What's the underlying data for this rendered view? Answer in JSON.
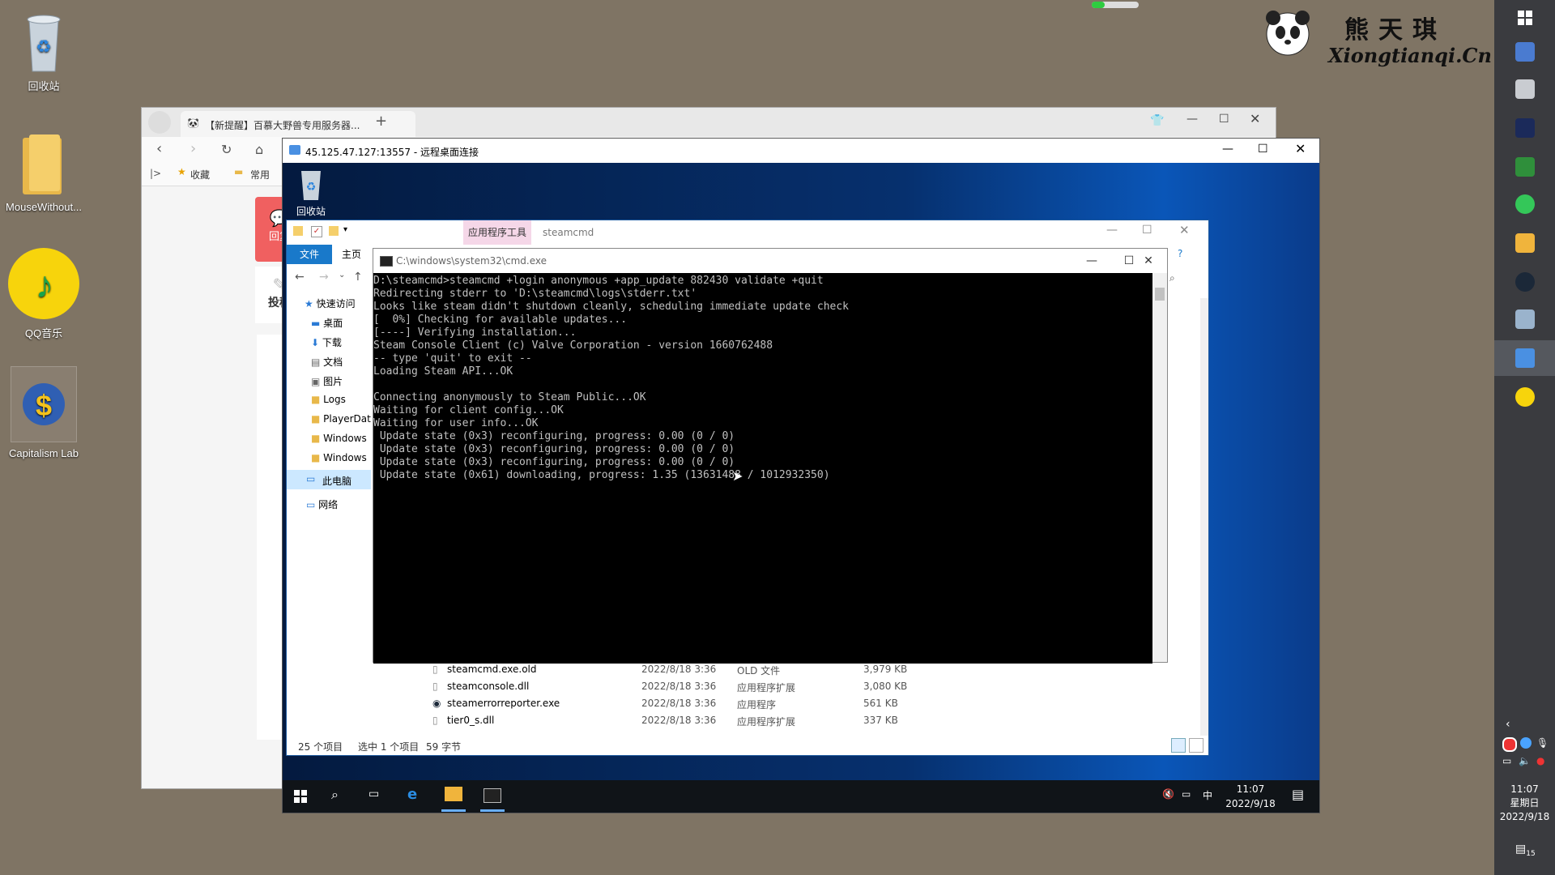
{
  "desktop": {
    "icons": [
      {
        "label": "回收站",
        "icon": "recycle-bin-icon"
      },
      {
        "label": "MouseWithout...",
        "icon": "folder-icon"
      },
      {
        "label": "QQ音乐",
        "icon": "qq-music-icon"
      },
      {
        "label": "Capitalism Lab",
        "icon": "capitalism-lab-icon"
      }
    ],
    "watermark": {
      "cn": "熊天琪",
      "en": "Xiongtianqi.Cn"
    }
  },
  "browser": {
    "tab_title": "【新提醒】百慕大野兽专用服务器...",
    "new_tab": "+",
    "bookmarks": {
      "favorites": "收藏",
      "common": "常用"
    },
    "side_buttons": {
      "reply": "回复",
      "post": "投稿"
    }
  },
  "rdp": {
    "title": "45.125.47.127:13557 - 远程桌面连接",
    "desktop_recycle": "回收站",
    "taskbar": {
      "time": "11:07",
      "date": "2022/9/18",
      "ime": "中"
    }
  },
  "explorer": {
    "ribbon_context": "应用程序工具",
    "window_title": "steamcmd",
    "tabs": {
      "file": "文件",
      "home": "主页"
    },
    "nav": {
      "quick_access": "快速访问",
      "items": [
        "桌面",
        "下载",
        "文档",
        "图片",
        "Logs",
        "PlayerDat",
        "Windows",
        "Windows"
      ],
      "this_pc": "此电脑",
      "network": "网络"
    },
    "files": [
      {
        "name": "steamcmd.exe.old",
        "date": "2022/8/18 3:36",
        "type": "OLD 文件",
        "size": "3,979 KB"
      },
      {
        "name": "steamconsole.dll",
        "date": "2022/8/18 3:36",
        "type": "应用程序扩展",
        "size": "3,080 KB"
      },
      {
        "name": "steamerrorreporter.exe",
        "date": "2022/8/18 3:36",
        "type": "应用程序",
        "size": "561 KB"
      },
      {
        "name": "tier0_s.dll",
        "date": "2022/8/18 3:36",
        "type": "应用程序扩展",
        "size": "337 KB"
      }
    ],
    "status": {
      "count": "25 个项目",
      "selected": "选中 1 个项目",
      "size": "59 字节"
    }
  },
  "cmd": {
    "title": "C:\\windows\\system32\\cmd.exe",
    "lines": "D:\\steamcmd>steamcmd +login anonymous +app_update 882430 validate +quit\nRedirecting stderr to 'D:\\steamcmd\\logs\\stderr.txt'\nLooks like steam didn't shutdown cleanly, scheduling immediate update check\n[  0%] Checking for available updates...\n[----] Verifying installation...\nSteam Console Client (c) Valve Corporation - version 1660762488\n-- type 'quit' to exit --\nLoading Steam API...OK\n\nConnecting anonymously to Steam Public...OK\nWaiting for client config...OK\nWaiting for user info...OK\n Update state (0x3) reconfiguring, progress: 0.00 (0 / 0)\n Update state (0x3) reconfiguring, progress: 0.00 (0 / 0)\n Update state (0x3) reconfiguring, progress: 0.00 (0 / 0)\n Update state (0x61) downloading, progress: 1.35 (13631488 / 1012932350)"
  },
  "host_clock": {
    "time": "11:07",
    "weekday": "星期日",
    "date": "2022/9/18",
    "badge": "15"
  }
}
